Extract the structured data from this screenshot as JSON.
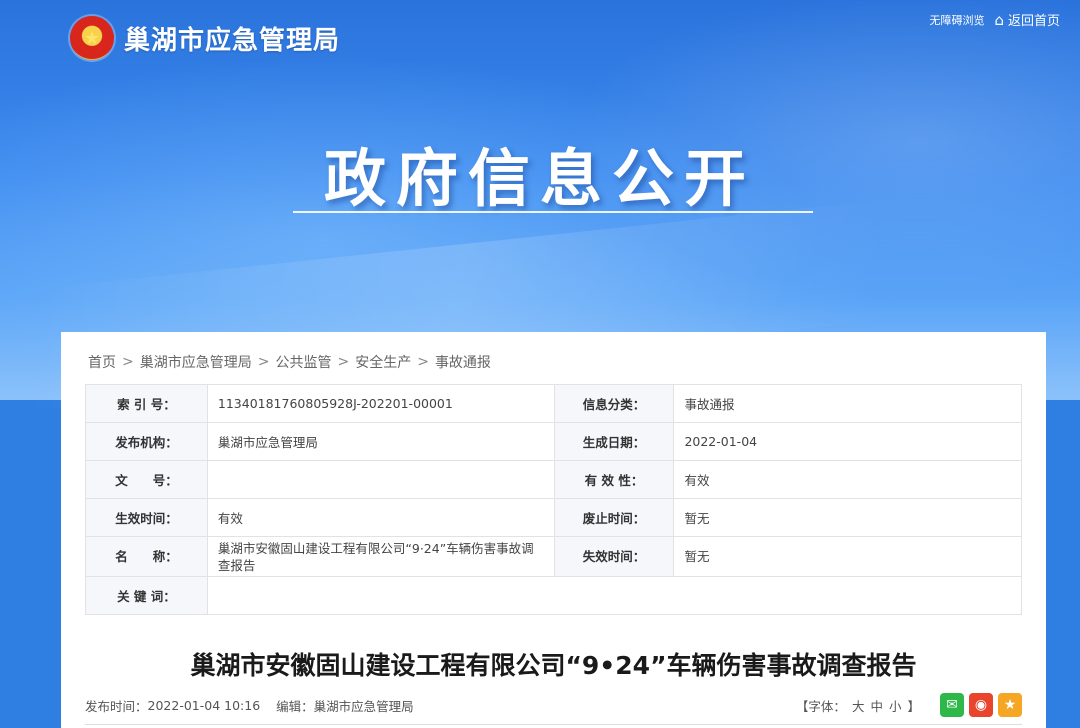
{
  "header": {
    "site_name": "巢湖市应急管理局",
    "emblem_icon": "national-emblem-icon",
    "accessible_label": "无障碍浏览",
    "home_label": "返回首页",
    "home_icon": "home-icon"
  },
  "banner": {
    "title": "政府信息公开"
  },
  "breadcrumb": [
    "首页",
    "巢湖市应急管理局",
    "公共监管",
    "安全生产",
    "事故通报"
  ],
  "breadcrumb_sep": ">",
  "meta": {
    "index_label": "索 引 号：",
    "index_value": "11340181760805928J-202201-00001",
    "category_label": "信息分类：",
    "category_value": "事故通报",
    "publisher_label": "发布机构：",
    "publisher_value": "巢湖市应急管理局",
    "created_label": "生成日期：",
    "created_value": "2022-01-04",
    "docno_label": "文　　号：",
    "docno_value": "",
    "validity_label": "有 效 性：",
    "validity_value": "有效",
    "effective_label": "生效时间：",
    "effective_value": "有效",
    "abolish_label": "废止时间：",
    "abolish_value": "暂无",
    "name_label": "名　　称：",
    "name_value": "巢湖市安徽固山建设工程有限公司“9·24”车辆伤害事故调查报告",
    "expire_label": "失效时间：",
    "expire_value": "暂无",
    "keywords_label": "关 键 词：",
    "keywords_value": ""
  },
  "article": {
    "title": "巢湖市安徽固山建设工程有限公司“9•24”车辆伤害事故调查报告",
    "publish_label": "发布时间：",
    "publish_time": "2022-01-04 10:16",
    "editor_label": "编辑：",
    "editor_value": "巢湖市应急管理局",
    "font_label_open": "【字体：",
    "font_large": "大",
    "font_medium": "中",
    "font_small": "小",
    "font_label_close": "】"
  },
  "share": {
    "wechat_icon": "wechat-icon",
    "weibo_icon": "weibo-icon",
    "favorite_icon": "star-icon"
  }
}
